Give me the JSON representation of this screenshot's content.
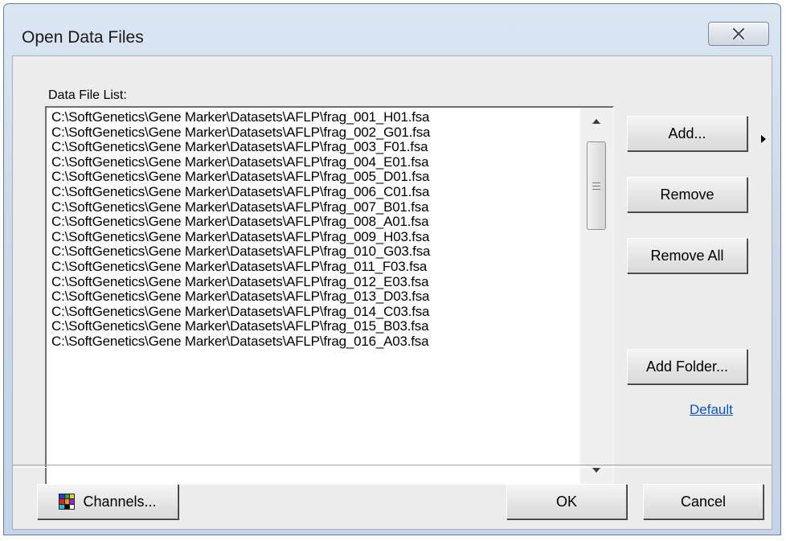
{
  "window": {
    "title": "Open Data Files"
  },
  "list": {
    "label": "Data File List:",
    "items": [
      "C:\\SoftGenetics\\Gene Marker\\Datasets\\AFLP\\frag_001_H01.fsa",
      "C:\\SoftGenetics\\Gene Marker\\Datasets\\AFLP\\frag_002_G01.fsa",
      "C:\\SoftGenetics\\Gene Marker\\Datasets\\AFLP\\frag_003_F01.fsa",
      "C:\\SoftGenetics\\Gene Marker\\Datasets\\AFLP\\frag_004_E01.fsa",
      "C:\\SoftGenetics\\Gene Marker\\Datasets\\AFLP\\frag_005_D01.fsa",
      "C:\\SoftGenetics\\Gene Marker\\Datasets\\AFLP\\frag_006_C01.fsa",
      "C:\\SoftGenetics\\Gene Marker\\Datasets\\AFLP\\frag_007_B01.fsa",
      "C:\\SoftGenetics\\Gene Marker\\Datasets\\AFLP\\frag_008_A01.fsa",
      "C:\\SoftGenetics\\Gene Marker\\Datasets\\AFLP\\frag_009_H03.fsa",
      "C:\\SoftGenetics\\Gene Marker\\Datasets\\AFLP\\frag_010_G03.fsa",
      "C:\\SoftGenetics\\Gene Marker\\Datasets\\AFLP\\frag_011_F03.fsa",
      "C:\\SoftGenetics\\Gene Marker\\Datasets\\AFLP\\frag_012_E03.fsa",
      "C:\\SoftGenetics\\Gene Marker\\Datasets\\AFLP\\frag_013_D03.fsa",
      "C:\\SoftGenetics\\Gene Marker\\Datasets\\AFLP\\frag_014_C03.fsa",
      "C:\\SoftGenetics\\Gene Marker\\Datasets\\AFLP\\frag_015_B03.fsa",
      "C:\\SoftGenetics\\Gene Marker\\Datasets\\AFLP\\frag_016_A03.fsa"
    ]
  },
  "buttons": {
    "add": "Add...",
    "remove": "Remove",
    "remove_all": "Remove All",
    "add_folder": "Add Folder...",
    "default_link": "Default",
    "channels": "Channels...",
    "ok": "OK",
    "cancel": "Cancel"
  },
  "icons": {
    "close": "close-icon",
    "add_menu": "triangle-right-icon",
    "scroll_up": "scroll-up-arrow-icon",
    "scroll_down": "scroll-down-arrow-icon",
    "channels": "color-grid-icon"
  },
  "colors": {
    "channel_grid": [
      "#1f3fd6",
      "#2aa640",
      "#e3d21c",
      "#d42424",
      "#ff8a1c",
      "#8a2bd0",
      "#1fbfd8",
      "#000000",
      "#ffffff"
    ],
    "link": "#0b54c9"
  }
}
